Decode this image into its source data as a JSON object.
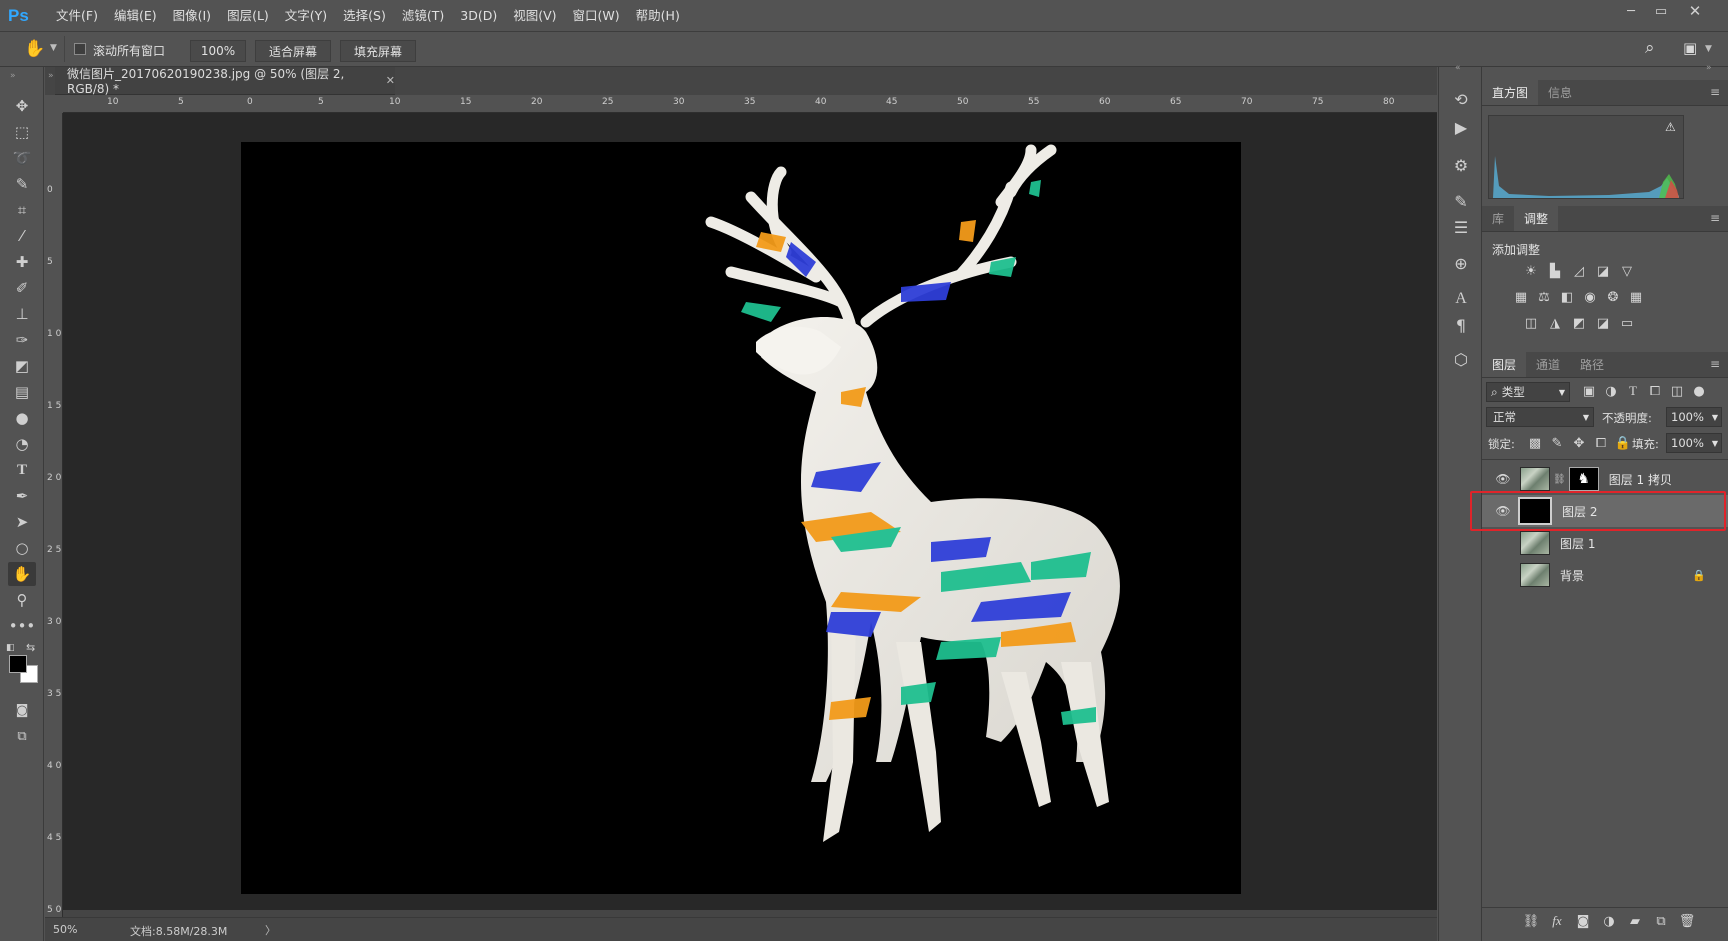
{
  "app": {
    "logo": "Ps"
  },
  "menubar": {
    "items": [
      "文件(F)",
      "编辑(E)",
      "图像(I)",
      "图层(L)",
      "文字(Y)",
      "选择(S)",
      "滤镜(T)",
      "3D(D)",
      "视图(V)",
      "窗口(W)",
      "帮助(H)"
    ],
    "window_controls": [
      "minimize-icon",
      "restore-icon",
      "close-icon"
    ]
  },
  "options": {
    "scroll_all_label": "滚动所有窗口",
    "scroll_all_checked": false,
    "zoom_100_label": "100%",
    "fit_screen_label": "适合屏幕",
    "fill_screen_label": "填充屏幕"
  },
  "document": {
    "tab_title": "微信图片_20170620190238.jpg @ 50% (图层 2, RGB/8) *",
    "ruler_top": [
      "10",
      "5",
      "0",
      "5",
      "10",
      "15",
      "20",
      "25",
      "30",
      "35",
      "40",
      "45",
      "50",
      "55",
      "60",
      "65",
      "70",
      "75",
      "80"
    ],
    "ruler_left": [
      "0",
      "5",
      "1 0",
      "1 5",
      "2 0",
      "2 5",
      "3 0",
      "3 5",
      "4 0",
      "4 5",
      "5 0"
    ],
    "canvas_bg": "#000000"
  },
  "status": {
    "zoom": "50%",
    "doc_size": "文档:8.58M/28.3M",
    "arrow": "〉"
  },
  "panels": {
    "histogram": {
      "tabs": [
        "直方图",
        "信息"
      ],
      "warning": "⚠"
    },
    "adjust": {
      "tabs": [
        "库",
        "调整"
      ],
      "title": "添加调整"
    },
    "layers": {
      "tabs": [
        "图层",
        "通道",
        "路径"
      ],
      "filter_kind": "类型",
      "blend_mode": "正常",
      "opacity_label": "不透明度:",
      "opacity_value": "100%",
      "lock_label": "锁定:",
      "fill_label": "填充:",
      "fill_value": "100%",
      "items": [
        {
          "name": "图层 1 拷贝",
          "visible": true,
          "selected": false,
          "has_mask": true,
          "locked": false
        },
        {
          "name": "图层 2",
          "visible": true,
          "selected": true,
          "has_mask": false,
          "locked": false
        },
        {
          "name": "图层 1",
          "visible": false,
          "selected": false,
          "has_mask": false,
          "locked": false
        },
        {
          "name": "背景",
          "visible": false,
          "selected": false,
          "has_mask": false,
          "locked": true
        }
      ]
    }
  },
  "colors": {
    "accent": "#31a8ff",
    "highlight_box": "#e0242a",
    "selected_row": "#6a6a6a"
  }
}
